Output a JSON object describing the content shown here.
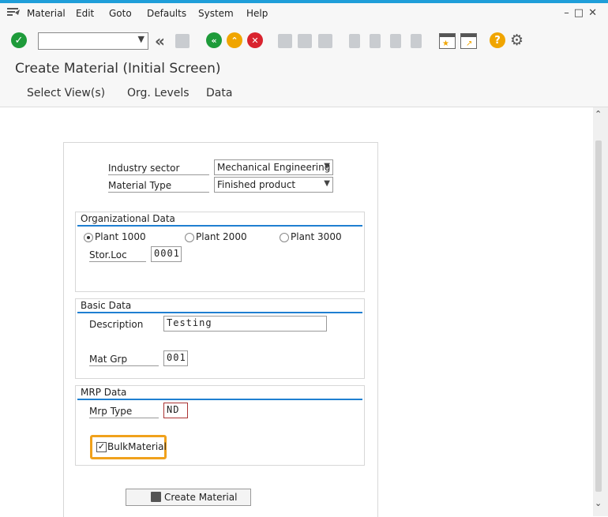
{
  "menu": {
    "items": [
      "Material",
      "Edit",
      "Goto",
      "Defaults",
      "System",
      "Help"
    ],
    "underline": [
      "M",
      "E",
      "G",
      "D",
      "S",
      "H"
    ]
  },
  "toolbar": {
    "nav_back": "«"
  },
  "page": {
    "title": "Create Material (Initial Screen)"
  },
  "app_toolbar": {
    "buttons": [
      "Select View(s)",
      "Org. Levels",
      "Data"
    ]
  },
  "form": {
    "industry_sector": {
      "label": "Industry sector",
      "value": "Mechanical Engineering"
    },
    "material_type": {
      "label": "Material Type",
      "value": "Finished product"
    },
    "org_data": {
      "title": "Organizational Data",
      "plants": [
        "Plant 1000",
        "Plant 2000",
        "Plant 3000"
      ],
      "selected_plant": "Plant 1000",
      "stor_loc": {
        "label": "Stor.Loc",
        "value": "0001"
      }
    },
    "basic_data": {
      "title": "Basic Data",
      "description": {
        "label": "Description",
        "value": "Testing"
      },
      "mat_grp": {
        "label": "Mat Grp",
        "value": "001"
      }
    },
    "mrp_data": {
      "title": "MRP Data",
      "mrp_type": {
        "label": "Mrp Type",
        "value": "ND"
      },
      "bulk_material": {
        "label": "BulkMaterial",
        "checked": true,
        "check_glyph": "✓"
      }
    },
    "create_button": {
      "label": "Create Material"
    }
  },
  "colors": {
    "accent_blue": "#1f9ed9",
    "group_line": "#1f7fd1",
    "enter_green": "#1e9b3a",
    "exit_orange": "#f0a500",
    "cancel_red": "#d9232e",
    "help_orange": "#f0a500",
    "highlight_orange": "#f0a11c"
  }
}
